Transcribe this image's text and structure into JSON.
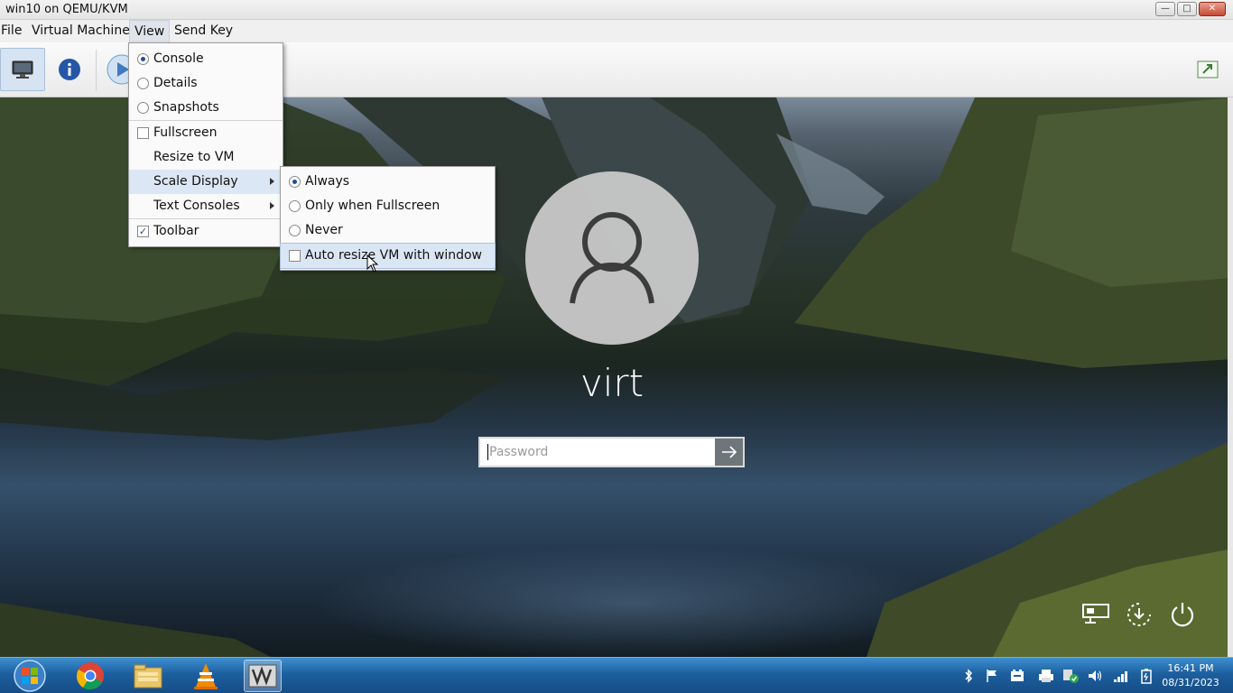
{
  "window": {
    "title": "win10 on QEMU/KVM"
  },
  "menubar": {
    "file": "File",
    "vm": "Virtual Machine",
    "view": "View",
    "sendkey": "Send Key"
  },
  "view_menu": {
    "console": "Console",
    "details": "Details",
    "snapshots": "Snapshots",
    "fullscreen": "Fullscreen",
    "resize": "Resize to VM",
    "scale": "Scale Display",
    "text_consoles": "Text Consoles",
    "toolbar": "Toolbar"
  },
  "scale_menu": {
    "always": "Always",
    "only_fullscreen": "Only when Fullscreen",
    "never": "Never",
    "auto_resize": "Auto resize VM with window"
  },
  "login": {
    "username": "virt",
    "password_placeholder": "Password"
  },
  "clock": {
    "time": "16:41 PM",
    "date": "08/31/2023"
  },
  "colors": {
    "taskbar": "#1d5f9e",
    "menu_highlight": "#dce7f5",
    "radio_dot": "#1f4f9a"
  }
}
